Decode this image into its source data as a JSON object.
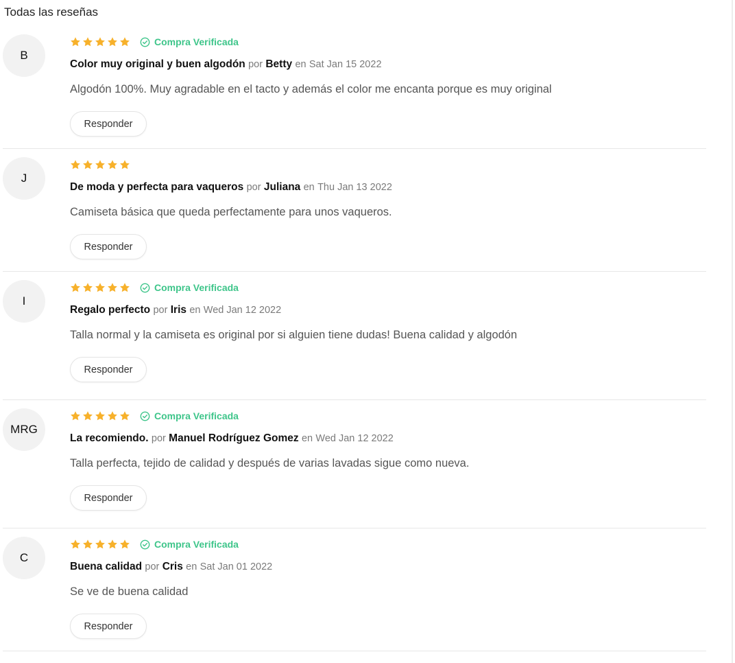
{
  "section_title": "Todas las reseñas",
  "colors": {
    "star": "#f7b12b",
    "verified": "#3ec58a"
  },
  "labels": {
    "by": "por",
    "on": "en",
    "reply": "Responder",
    "verified": "Compra Verificada"
  },
  "reviews": [
    {
      "initials": "B",
      "rating": 5,
      "verified": true,
      "title": "Color muy original y buen algodón",
      "author": "Betty",
      "date": "Sat Jan 15 2022",
      "body": "Algodón 100%. Muy agradable en el tacto y además el color me encanta porque es muy original"
    },
    {
      "initials": "J",
      "rating": 5,
      "verified": false,
      "title": "De moda y perfecta para vaqueros",
      "author": "Juliana",
      "date": "Thu Jan 13 2022",
      "body": "Camiseta básica que queda perfectamente para unos vaqueros."
    },
    {
      "initials": "I",
      "rating": 5,
      "verified": true,
      "title": "Regalo perfecto",
      "author": "Iris",
      "date": "Wed Jan 12 2022",
      "body": "Talla normal y la camiseta es original por si alguien tiene dudas! Buena calidad y algodón"
    },
    {
      "initials": "MRG",
      "rating": 5,
      "verified": true,
      "title": "La recomiendo.",
      "author": "Manuel Rodríguez Gomez",
      "date": "Wed Jan 12 2022",
      "body": "Talla perfecta, tejido de calidad y después de varias lavadas sigue como nueva."
    },
    {
      "initials": "C",
      "rating": 5,
      "verified": true,
      "title": "Buena calidad",
      "author": "Cris",
      "date": "Sat Jan 01 2022",
      "body": "Se ve de buena calidad"
    }
  ]
}
